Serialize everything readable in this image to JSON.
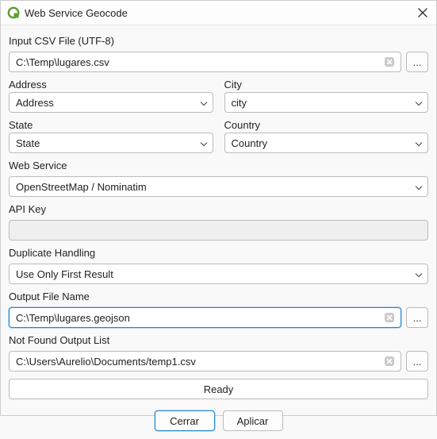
{
  "window": {
    "title": "Web Service Geocode"
  },
  "fields": {
    "input_csv": {
      "label": "Input CSV File (UTF-8)",
      "value": "C:\\Temp\\lugares.csv"
    },
    "address": {
      "label": "Address",
      "value": "Address"
    },
    "city": {
      "label": "City",
      "value": "city"
    },
    "state": {
      "label": "State",
      "value": "State"
    },
    "country": {
      "label": "Country",
      "value": "Country"
    },
    "webservice": {
      "label": "Web Service",
      "value": "OpenStreetMap / Nominatim"
    },
    "apikey": {
      "label": "API Key",
      "value": ""
    },
    "duplicate": {
      "label": "Duplicate Handling",
      "value": "Use Only First Result"
    },
    "output": {
      "label": "Output File Name",
      "value": "C:\\Temp\\lugares.geojson"
    },
    "notfound": {
      "label": "Not Found Output List",
      "value": "C:\\Users\\Aurelio\\Documents/temp1.csv"
    }
  },
  "status": "Ready",
  "buttons": {
    "browse": "...",
    "close": "Cerrar",
    "apply": "Aplicar"
  }
}
